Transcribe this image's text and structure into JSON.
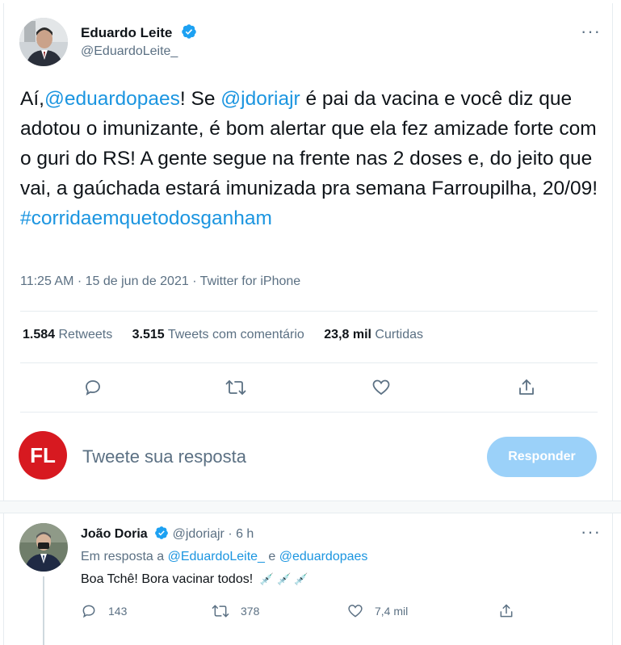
{
  "tweet": {
    "author_name": "Eduardo Leite",
    "author_handle": "@EduardoLeite_",
    "text_intro": "Aí,",
    "mention1": "@eduardopaes",
    "text_mid1": "! Se ",
    "mention2": "@jdoriajr",
    "text_body": " é pai da vacina e você diz que adotou o imunizante, é bom alertar que ela fez amizade forte com o guri do RS! A gente segue na frente nas 2 doses e, do jeito que vai, a gaúchada estará imunizada pra semana Farroupilha, 20/09!",
    "hashtag": "#corridaemquetodosganham",
    "timestamp": "11:25 AM · 15 de jun de 2021 · Twitter for iPhone",
    "retweets_count": "1.584",
    "retweets_label": "Retweets",
    "quotes_count": "3.515",
    "quotes_label": "Tweets com comentário",
    "likes_count": "23,8 mil",
    "likes_label": "Curtidas",
    "more_label": "···"
  },
  "reply_box": {
    "avatar_text": "FL",
    "placeholder": "Tweete sua resposta",
    "button_label": "Responder"
  },
  "reply": {
    "author_name": "João Doria",
    "author_handle": "@jdoriajr",
    "time": "· 6 h",
    "in_reply_prefix": "Em resposta a",
    "in_reply_user1": "@EduardoLeite_",
    "in_reply_and": "e",
    "in_reply_user2": "@eduardopaes",
    "text": "Boa Tchê! Bora vacinar todos!",
    "emoji": "💉 💉 💉",
    "replies_count": "143",
    "retweets_count": "378",
    "likes_count": "7,4 mil",
    "more_label": "···"
  },
  "icons": [
    "verified-badge-icon",
    "reply-icon",
    "retweet-icon",
    "like-icon",
    "share-icon",
    "more-icon"
  ],
  "colors": {
    "link_blue": "#1b95e0",
    "button_disabled": "#9bd1f9",
    "fl_red": "#d71920",
    "text_gray": "#5b7083"
  }
}
